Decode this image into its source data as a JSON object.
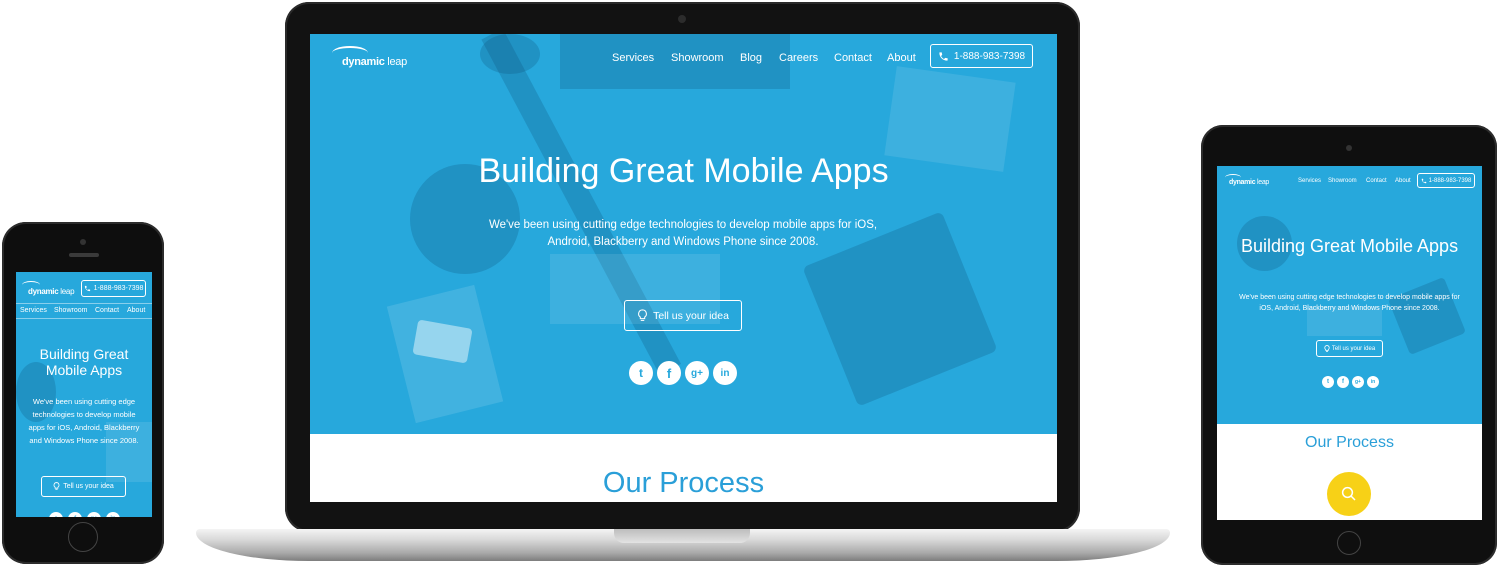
{
  "brand": {
    "name_bold": "dynamic",
    "name_light": "leap"
  },
  "nav": {
    "desktop": [
      "Services",
      "Showroom",
      "Blog",
      "Careers",
      "Contact",
      "About"
    ],
    "mobile": [
      "Services",
      "Showroom",
      "Contact",
      "About"
    ],
    "tablet": [
      "Services",
      "Showroom",
      "Contact",
      "About"
    ]
  },
  "phone_number": "1-888-983-7398",
  "hero": {
    "title": "Building Great Mobile Apps",
    "subtitle": "We've been using cutting edge technologies to develop mobile apps for iOS, Android, Blackberry and Windows Phone since 2008.",
    "cta_label": "Tell us your idea"
  },
  "social": [
    {
      "name": "twitter",
      "glyph": "t"
    },
    {
      "name": "facebook",
      "glyph": "f"
    },
    {
      "name": "google-plus",
      "glyph": "g+"
    },
    {
      "name": "linkedin",
      "glyph": "in"
    }
  ],
  "process": {
    "title": "Our Process"
  },
  "colors": {
    "hero_blue": "#27a8dc",
    "accent_yellow": "#f7d117",
    "process_blue": "#2a9fd8"
  }
}
